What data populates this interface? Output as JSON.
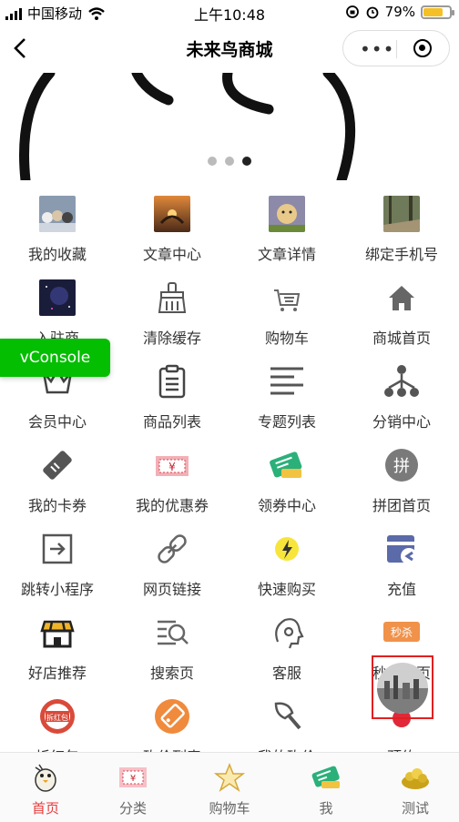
{
  "status_bar": {
    "carrier": "中国移动",
    "time": "上午10:48",
    "battery": "79%"
  },
  "nav": {
    "title": "未来鸟商城"
  },
  "banner": {
    "active_dot": 3,
    "dot_count": 3
  },
  "grid": [
    {
      "label": "我的收藏",
      "icon": "photo-puppies"
    },
    {
      "label": "文章中心",
      "icon": "photo-sunset"
    },
    {
      "label": "文章详情",
      "icon": "photo-puppy"
    },
    {
      "label": "绑定手机号",
      "icon": "photo-forest"
    },
    {
      "label": "入驻商",
      "icon": "photo-space"
    },
    {
      "label": "清除缓存",
      "icon": "broom-icon"
    },
    {
      "label": "购物车",
      "icon": "cart-icon"
    },
    {
      "label": "商城首页",
      "icon": "home-icon"
    },
    {
      "label": "会员中心",
      "icon": "crown-icon"
    },
    {
      "label": "商品列表",
      "icon": "clipboard-icon"
    },
    {
      "label": "专题列表",
      "icon": "list-icon"
    },
    {
      "label": "分销中心",
      "icon": "network-icon"
    },
    {
      "label": "我的卡券",
      "icon": "ticket-icon"
    },
    {
      "label": "我的优惠券",
      "icon": "coupon-icon"
    },
    {
      "label": "领券中心",
      "icon": "coupon-green-icon"
    },
    {
      "label": "拼团首页",
      "icon": "pin-icon"
    },
    {
      "label": "跳转小程序",
      "icon": "jump-icon"
    },
    {
      "label": "网页链接",
      "icon": "link-icon"
    },
    {
      "label": "快速购买",
      "icon": "lightning-icon"
    },
    {
      "label": "充值",
      "icon": "wallet-icon"
    },
    {
      "label": "好店推荐",
      "icon": "store-icon"
    },
    {
      "label": "搜索页",
      "icon": "search-list-icon"
    },
    {
      "label": "客服",
      "icon": "headset-icon"
    },
    {
      "label": "秒杀首页",
      "icon": "flash-sale-icon"
    },
    {
      "label": "拆红包",
      "icon": "red-packet-icon"
    },
    {
      "label": "砍价列表",
      "icon": "bargain-icon"
    },
    {
      "label": "我的砍价",
      "icon": "axe-icon"
    },
    {
      "label": "预约",
      "icon": "appointment-icon"
    }
  ],
  "badges": {
    "coupon": "¥",
    "pin": "拼",
    "flash_sale": "秒杀",
    "red_packet": "拆红包"
  },
  "vconsole": {
    "label": "vConsole"
  },
  "tabbar": [
    {
      "label": "首页",
      "active": true
    },
    {
      "label": "分类",
      "active": false
    },
    {
      "label": "购物车",
      "active": false
    },
    {
      "label": "我",
      "active": false
    },
    {
      "label": "测试",
      "active": false
    }
  ],
  "colors": {
    "accent": "#e83b3b",
    "vconsole": "#04be02"
  }
}
